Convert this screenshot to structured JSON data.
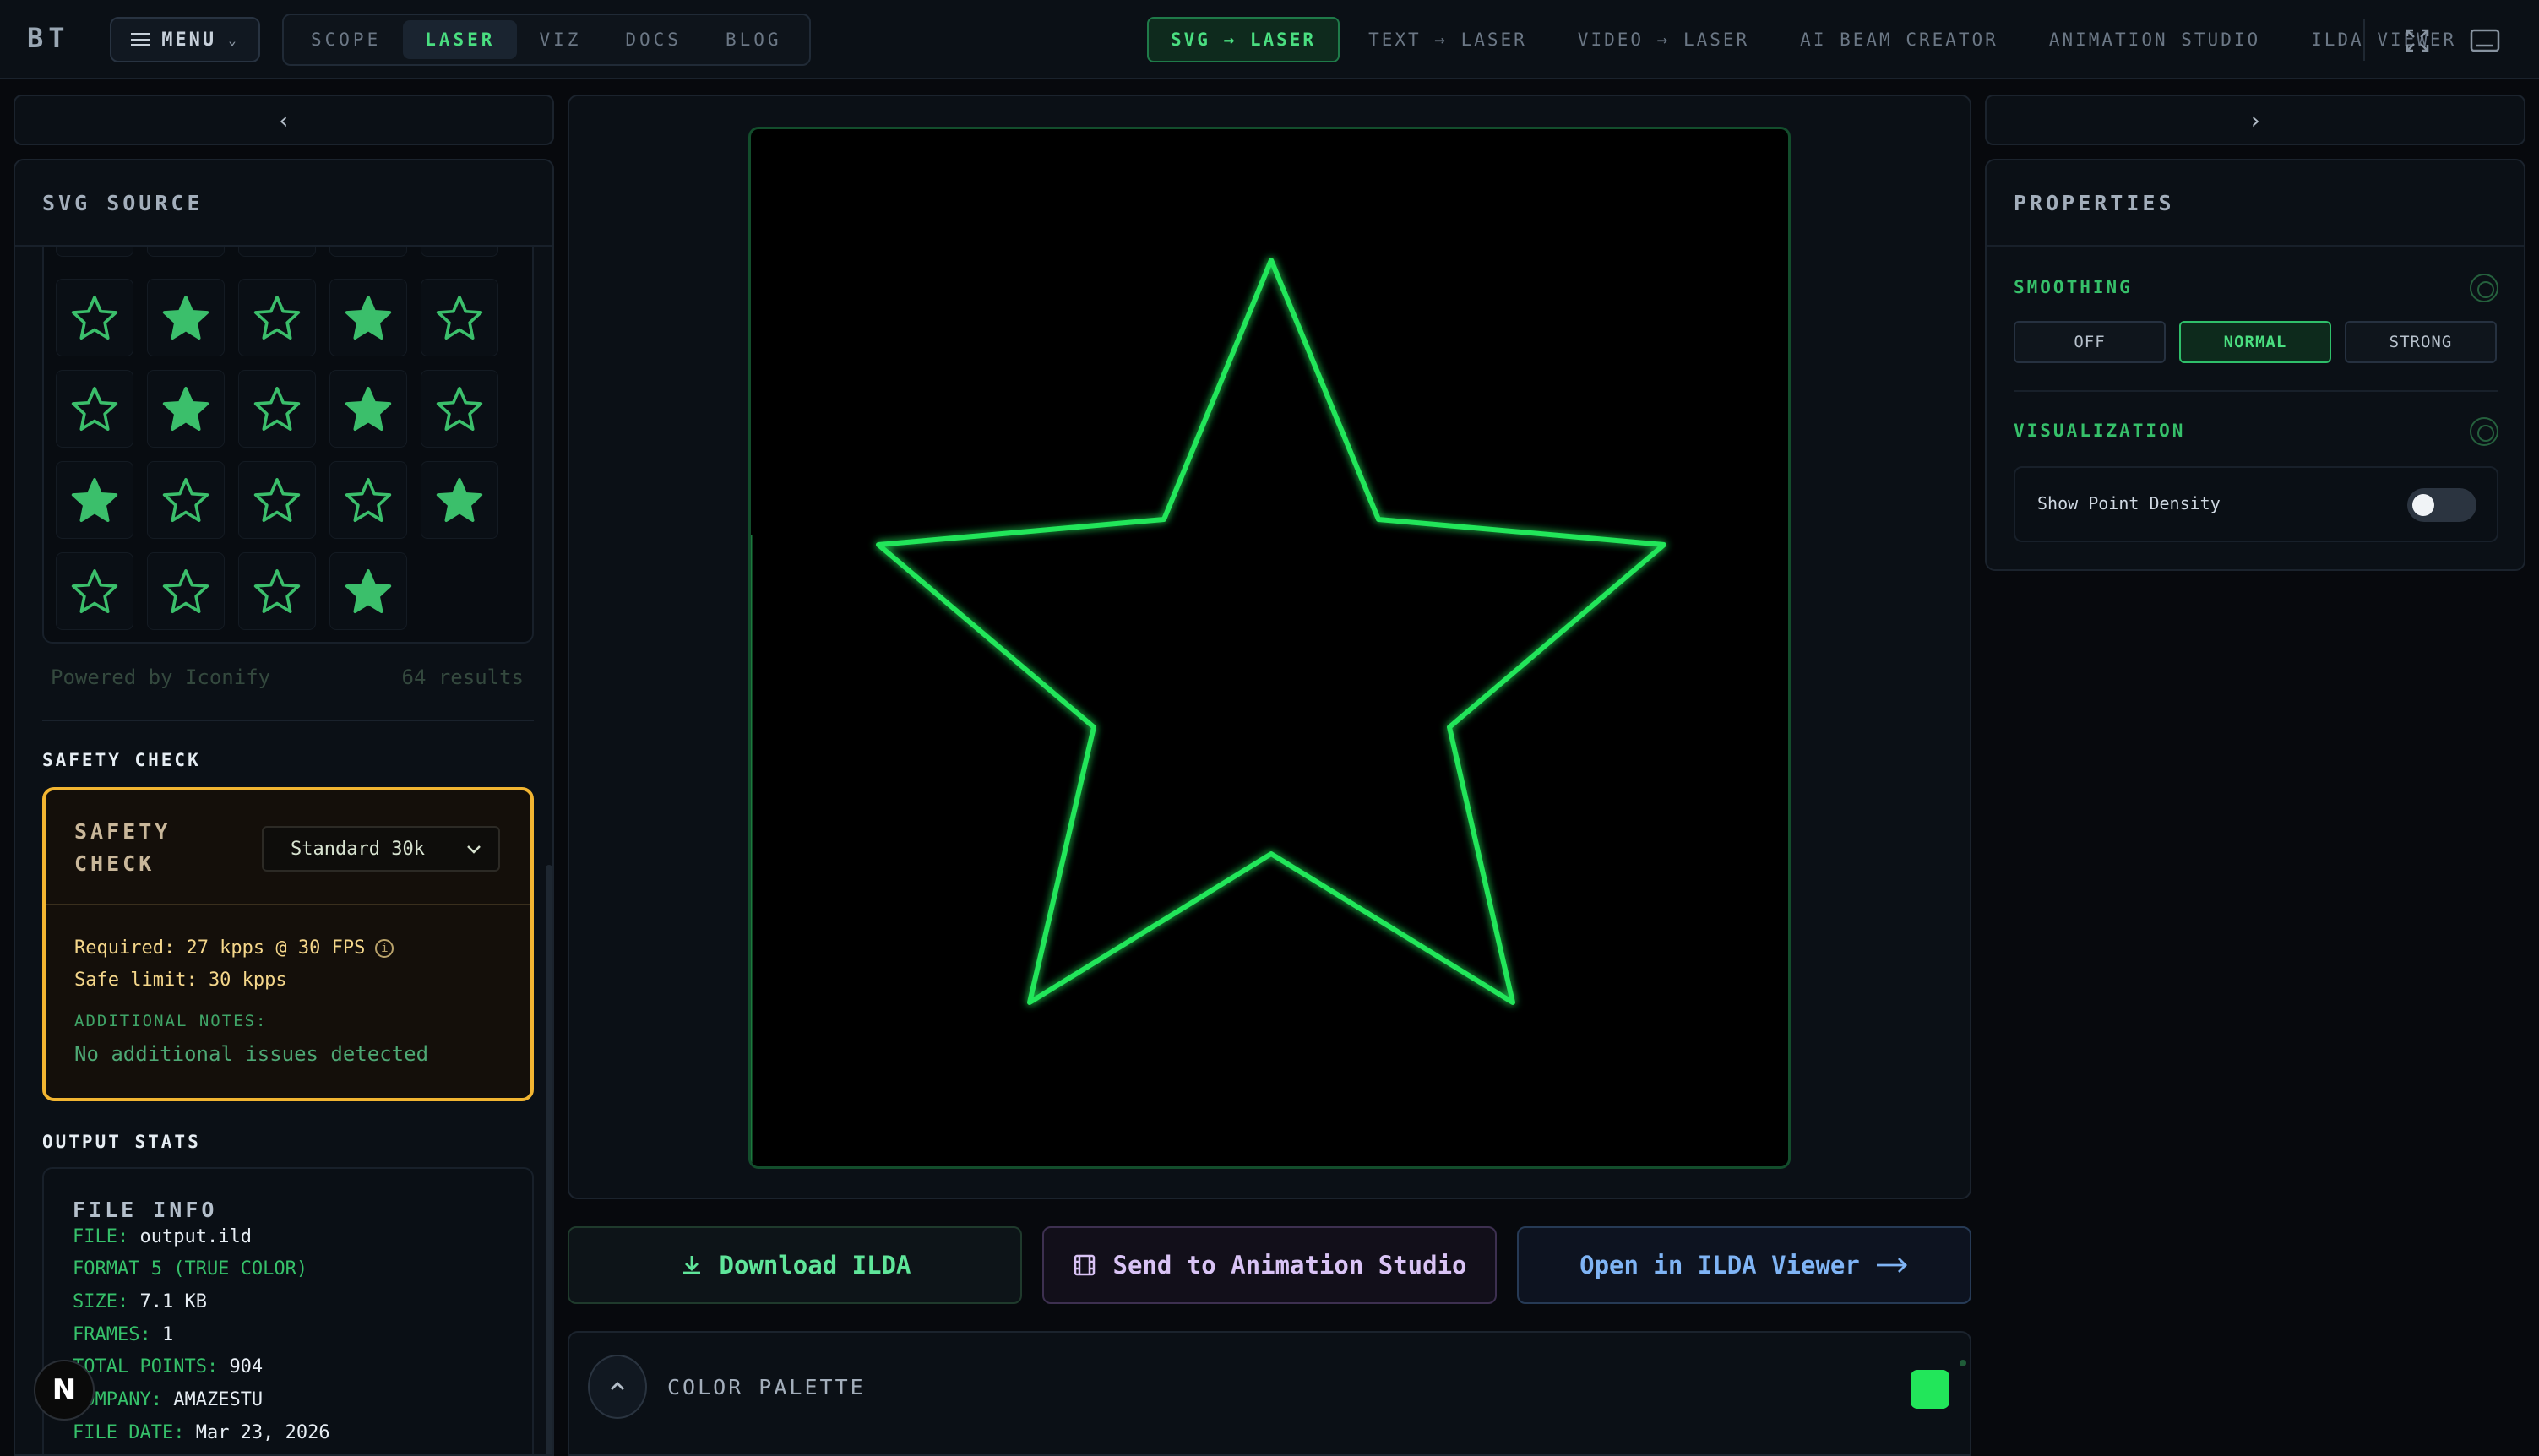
{
  "header": {
    "logo": "BT",
    "menu_label": "MENU",
    "tabs": [
      {
        "label": "SCOPE"
      },
      {
        "label": "LASER"
      },
      {
        "label": "VIZ"
      },
      {
        "label": "DOCS"
      },
      {
        "label": "BLOG"
      }
    ],
    "active_tab": "LASER",
    "modes": [
      {
        "label": "SVG → LASER"
      },
      {
        "label": "TEXT → LASER"
      },
      {
        "label": "VIDEO → LASER"
      },
      {
        "label": "AI BEAM CREATOR"
      },
      {
        "label": "ANIMATION STUDIO"
      },
      {
        "label": "ILDA VIEWER"
      }
    ],
    "active_mode": "SVG → LASER",
    "icons": {
      "fullscreen": "expand-icon",
      "display": "monitor-icon",
      "menu": "hamburger-icon"
    }
  },
  "left": {
    "collapse_icon": "chevron-left-icon",
    "title": "SVG SOURCE",
    "icon_results": {
      "powered_by": "Powered by Iconify",
      "count": "64 results",
      "icon_style_sequence": [
        "outline",
        "filled",
        "outline",
        "filled",
        "outline",
        "outline",
        "filled",
        "outline",
        "filled",
        "outline",
        "filled",
        "outline",
        "outline",
        "outline",
        "filled",
        "outline",
        "outline",
        "outline",
        "filled"
      ]
    },
    "safety_check": {
      "section_label": "SAFETY CHECK",
      "box_title_line1": "SAFETY",
      "box_title_line2": "CHECK",
      "selected_profile": "Standard 30k",
      "required": "Required: 27 kpps @ 30 FPS",
      "safe_limit": "Safe limit: 30 kpps",
      "notes_label": "ADDITIONAL NOTES:",
      "notes": "No additional issues detected"
    },
    "output_stats": {
      "section_label": "OUTPUT STATS",
      "title": "FILE INFO",
      "file_key": "FILE:",
      "file_value": "output.ild",
      "format": "FORMAT 5 (TRUE COLOR)",
      "size_key": "SIZE:",
      "size_value": "7.1 KB",
      "frames_key": "FRAMES:",
      "frames_value": "1",
      "points_key": "TOTAL POINTS:",
      "points_value": "904",
      "company_key": "COMPANY:",
      "company_value": "AMAZESTU",
      "date_key": "FILE DATE:",
      "date_value": "Mar 23, 2026"
    },
    "badge_letter": "N"
  },
  "center": {
    "preview_shape": "star",
    "beam_color": "#22e65a",
    "actions": {
      "download": "Download ILDA",
      "send": "Send to Animation Studio",
      "open": "Open in ILDA Viewer"
    },
    "palette_label": "COLOR PALETTE",
    "palette_swatch": "#22e65a"
  },
  "right": {
    "collapse_icon": "chevron-right-icon",
    "title": "PROPERTIES",
    "smoothing_label": "SMOOTHING",
    "smoothing_options": [
      {
        "label": "OFF"
      },
      {
        "label": "NORMAL"
      },
      {
        "label": "STRONG"
      }
    ],
    "smoothing_selected": "NORMAL",
    "visualization_label": "VISUALIZATION",
    "show_point_density_label": "Show Point Density",
    "show_point_density": false
  }
}
